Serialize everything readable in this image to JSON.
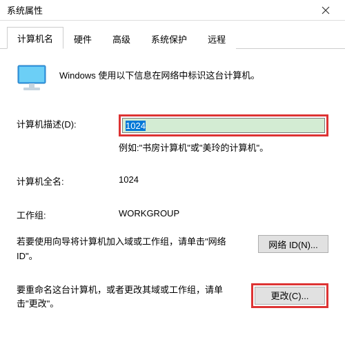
{
  "window": {
    "title": "系统属性"
  },
  "tabs": {
    "computer_name": "计算机名",
    "hardware": "硬件",
    "advanced": "高级",
    "system_protection": "系统保护",
    "remote": "远程"
  },
  "intro": {
    "text": "Windows 使用以下信息在网络中标识这台计算机。"
  },
  "description": {
    "label": "计算机描述(D):",
    "value": "1024",
    "example": "例如:\"书房计算机\"或\"美玲的计算机\"。"
  },
  "full_name": {
    "label": "计算机全名:",
    "value": "1024"
  },
  "workgroup": {
    "label": "工作组:",
    "value": "WORKGROUP"
  },
  "network_id": {
    "text": "若要使用向导将计算机加入域或工作组，请单击\"网络 ID\"。",
    "button": "网络 ID(N)..."
  },
  "change": {
    "text": "要重命名这台计算机，或者更改其域或工作组，请单击\"更改\"。",
    "button": "更改(C)..."
  }
}
